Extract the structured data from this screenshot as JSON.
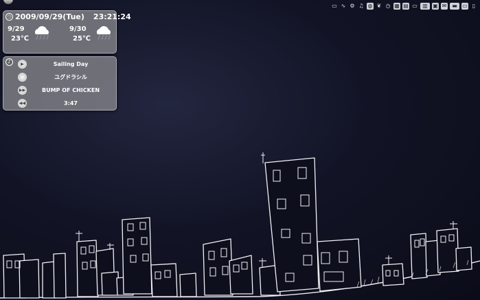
{
  "tray": {
    "icons": [
      "folder-icon",
      "activity-icon",
      "gear-icon",
      "music-icon",
      "globe-icon",
      "leaf-icon",
      "clock-icon",
      "calculator-icon",
      "document-icon",
      "monitor-icon",
      "keyboard-icon",
      "window-icon",
      "mail-icon",
      "disk-icon",
      "scanner-icon",
      "trash-icon"
    ]
  },
  "weather": {
    "date": "2009/09/29(Tue)",
    "time": "23:21:24",
    "forecast": [
      {
        "date": "9/29",
        "temp": "23℃",
        "icon": "rain-cloud-icon"
      },
      {
        "date": "9/30",
        "temp": "25℃",
        "icon": "rain-cloud-icon"
      }
    ]
  },
  "music": {
    "title": "Sailing Day",
    "album": "ユグドラシル",
    "artist": "BUMP OF CHICKEN",
    "duration": "3:47"
  },
  "colors": {
    "sky": "#121426",
    "widget_bg": "#87878c",
    "sketch": "#ffffff"
  }
}
